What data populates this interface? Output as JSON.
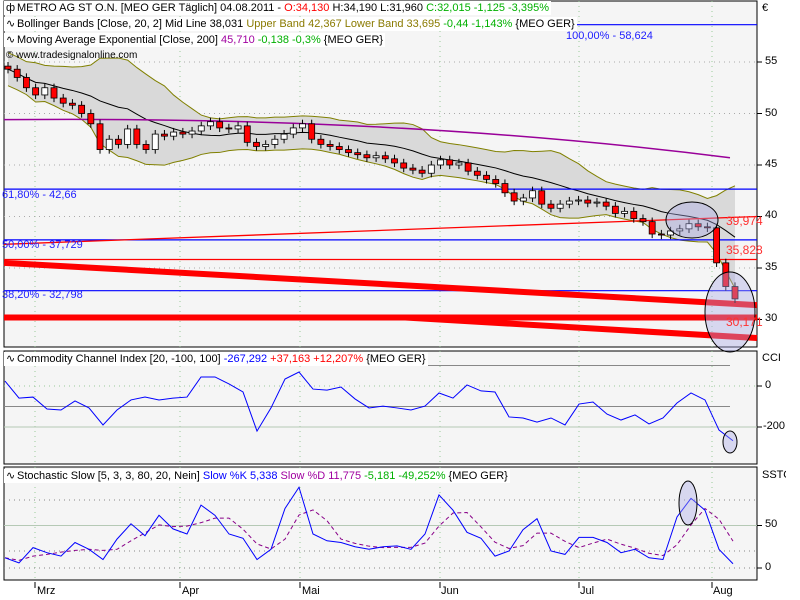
{
  "colors": {
    "up": "#ffffff",
    "down": "#ff0000",
    "band_fill": "#d9d9d9",
    "band_line": "#808000",
    "mid": "#000000",
    "ema": "#990099",
    "fib": "#0000ff",
    "trend": "#ff0000",
    "cci": "#0000ff",
    "k": "#0000ff",
    "d": "#880088"
  },
  "legend": {
    "main": {
      "name": "METRO AG ST O.N. [MEO GER  Täglich] 04.08.2011 - ",
      "open": "O:34,130",
      "hl": " H:34,190 L:31,960 ",
      "close": "C:32,015 -1,125 -3,395%"
    },
    "bb": {
      "name": "Bollinger Bands [Close, 20, 2] Mid Line 38,031 ",
      "bands": "Upper Band 42,367 Lower Band 33,695",
      "chg": " -0,44 -1,143%",
      "sym": " {MEO GER}"
    },
    "ema": {
      "name": "Moving Average Exponential [Close, 200] ",
      "value": "45,710",
      "chg": " -0,138 -0,3%",
      "sym": " {MEO GER}"
    },
    "watermark": "© www.tradesignalonline.com",
    "cci": {
      "name": "Commodity Channel Index [20, -100, 100] ",
      "value": "-267,292",
      "chg": " +37,163 +12,207%",
      "sym": " {MEO GER}"
    },
    "stoch": {
      "name": "Stochastic Slow [5, 3, 3, 80, 20, Nein] ",
      "k": "Slow %K 5,338",
      "d": " Slow %D 11,775",
      "chg": " -5,181 -49,252%",
      "sym": " {MEO GER}"
    }
  },
  "axes": {
    "currency": "€",
    "price_ticks": [
      "55",
      "50",
      "45",
      "40",
      "35",
      "30"
    ],
    "cci_title": "CCI",
    "cci_ticks": [
      "0",
      "-200"
    ],
    "stoch_title": "SSTO",
    "stoch_ticks": [
      "50",
      "0"
    ],
    "months": [
      "Mrz",
      "Apr",
      "Mai",
      "Jun",
      "Jul",
      "Aug"
    ]
  },
  "annotations": {
    "fib": [
      {
        "label": "61,80% - 42,66",
        "value": 42.66
      },
      {
        "label": "50,00% - 37,729",
        "value": 37.729
      },
      {
        "label": "38,20% - 32,798",
        "value": 32.798
      },
      {
        "label": "100,00% - 58,624",
        "value": 58.624
      }
    ],
    "red_labels": [
      {
        "label": "39,974",
        "value": 39.974
      },
      {
        "label": "35,828",
        "value": 35.828
      },
      {
        "label": "30,171",
        "value": 30.171
      }
    ]
  },
  "chart_data": [
    {
      "type": "candlestick",
      "title": "METRO AG ST O.N. [MEO GER Täglich]",
      "ylim": [
        27,
        59
      ],
      "closes": [
        54.3,
        53.5,
        52.5,
        51.8,
        52.5,
        51.5,
        51,
        50.8,
        50,
        49,
        46.5,
        47.5,
        47,
        48.5,
        47,
        46.5,
        48,
        47.8,
        48.2,
        48,
        48.3,
        48.8,
        49.2,
        48.6,
        48.5,
        48.8,
        47.2,
        46.8,
        47,
        47.5,
        48,
        48.6,
        49,
        47.5,
        47,
        46.8,
        46.5,
        46.2,
        46,
        45.7,
        45.9,
        45.6,
        45.2,
        44.7,
        44.5,
        44.2,
        45,
        45.5,
        45,
        45.2,
        44.4,
        44,
        43.6,
        43.2,
        42.3,
        41.5,
        41.8,
        42.5,
        41.2,
        40.8,
        41.2,
        41.5,
        41.6,
        41.3,
        41.4,
        41,
        40.3,
        40.5,
        39.8,
        39.5,
        38.3,
        38.2,
        38.6,
        38.8,
        39.3,
        39,
        38.9,
        35.5,
        33.2,
        32.0
      ],
      "ema200": {
        "start": 49.4,
        "end": 45.7
      },
      "trendlines": [
        {
          "from": 37.3,
          "to": 40.0,
          "width": "thin"
        },
        {
          "from": 35.828,
          "to": 35.828,
          "width": "thin"
        },
        {
          "from": 35.5,
          "to": 31.4,
          "width": "thick"
        },
        {
          "from": 30.2,
          "to": 30.2,
          "width": "thick"
        },
        {
          "from": 30.2,
          "to": 28.2,
          "width": "thick",
          "start_fraction": 0.53
        }
      ]
    },
    {
      "type": "line",
      "title": "Commodity Channel Index",
      "ylim": [
        -330,
        170
      ],
      "levels": [
        0,
        -100,
        100,
        -200
      ],
      "values": [
        24,
        -59,
        -54,
        -112,
        -117,
        -73,
        -107,
        -190,
        -117,
        -68,
        -54,
        -68,
        -59,
        -54,
        44,
        44,
        10,
        -29,
        -220,
        -107,
        34,
        68,
        -15,
        -20,
        -5,
        -63,
        -107,
        -98,
        -107,
        -117,
        -98,
        -34,
        -59,
        5,
        -24,
        -29,
        -151,
        -156,
        -176,
        -156,
        -190,
        -88,
        -78,
        -137,
        -166,
        -141,
        -185,
        -156,
        -83,
        -34,
        -68,
        -215,
        -267
      ]
    },
    {
      "type": "line",
      "title": "Stochastic Slow",
      "ylim": [
        -10,
        115
      ],
      "levels": [
        80,
        50,
        20,
        0
      ],
      "k": [
        12,
        6,
        24,
        18,
        14,
        30,
        22,
        10,
        34,
        52,
        38,
        62,
        46,
        40,
        74,
        62,
        40,
        35,
        10,
        22,
        70,
        95,
        40,
        32,
        30,
        25,
        22,
        25,
        26,
        22,
        40,
        86,
        68,
        42,
        35,
        14,
        20,
        45,
        58,
        20,
        16,
        36,
        36,
        30,
        18,
        22,
        12,
        10,
        60,
        82,
        68,
        22,
        5
      ]
    }
  ]
}
